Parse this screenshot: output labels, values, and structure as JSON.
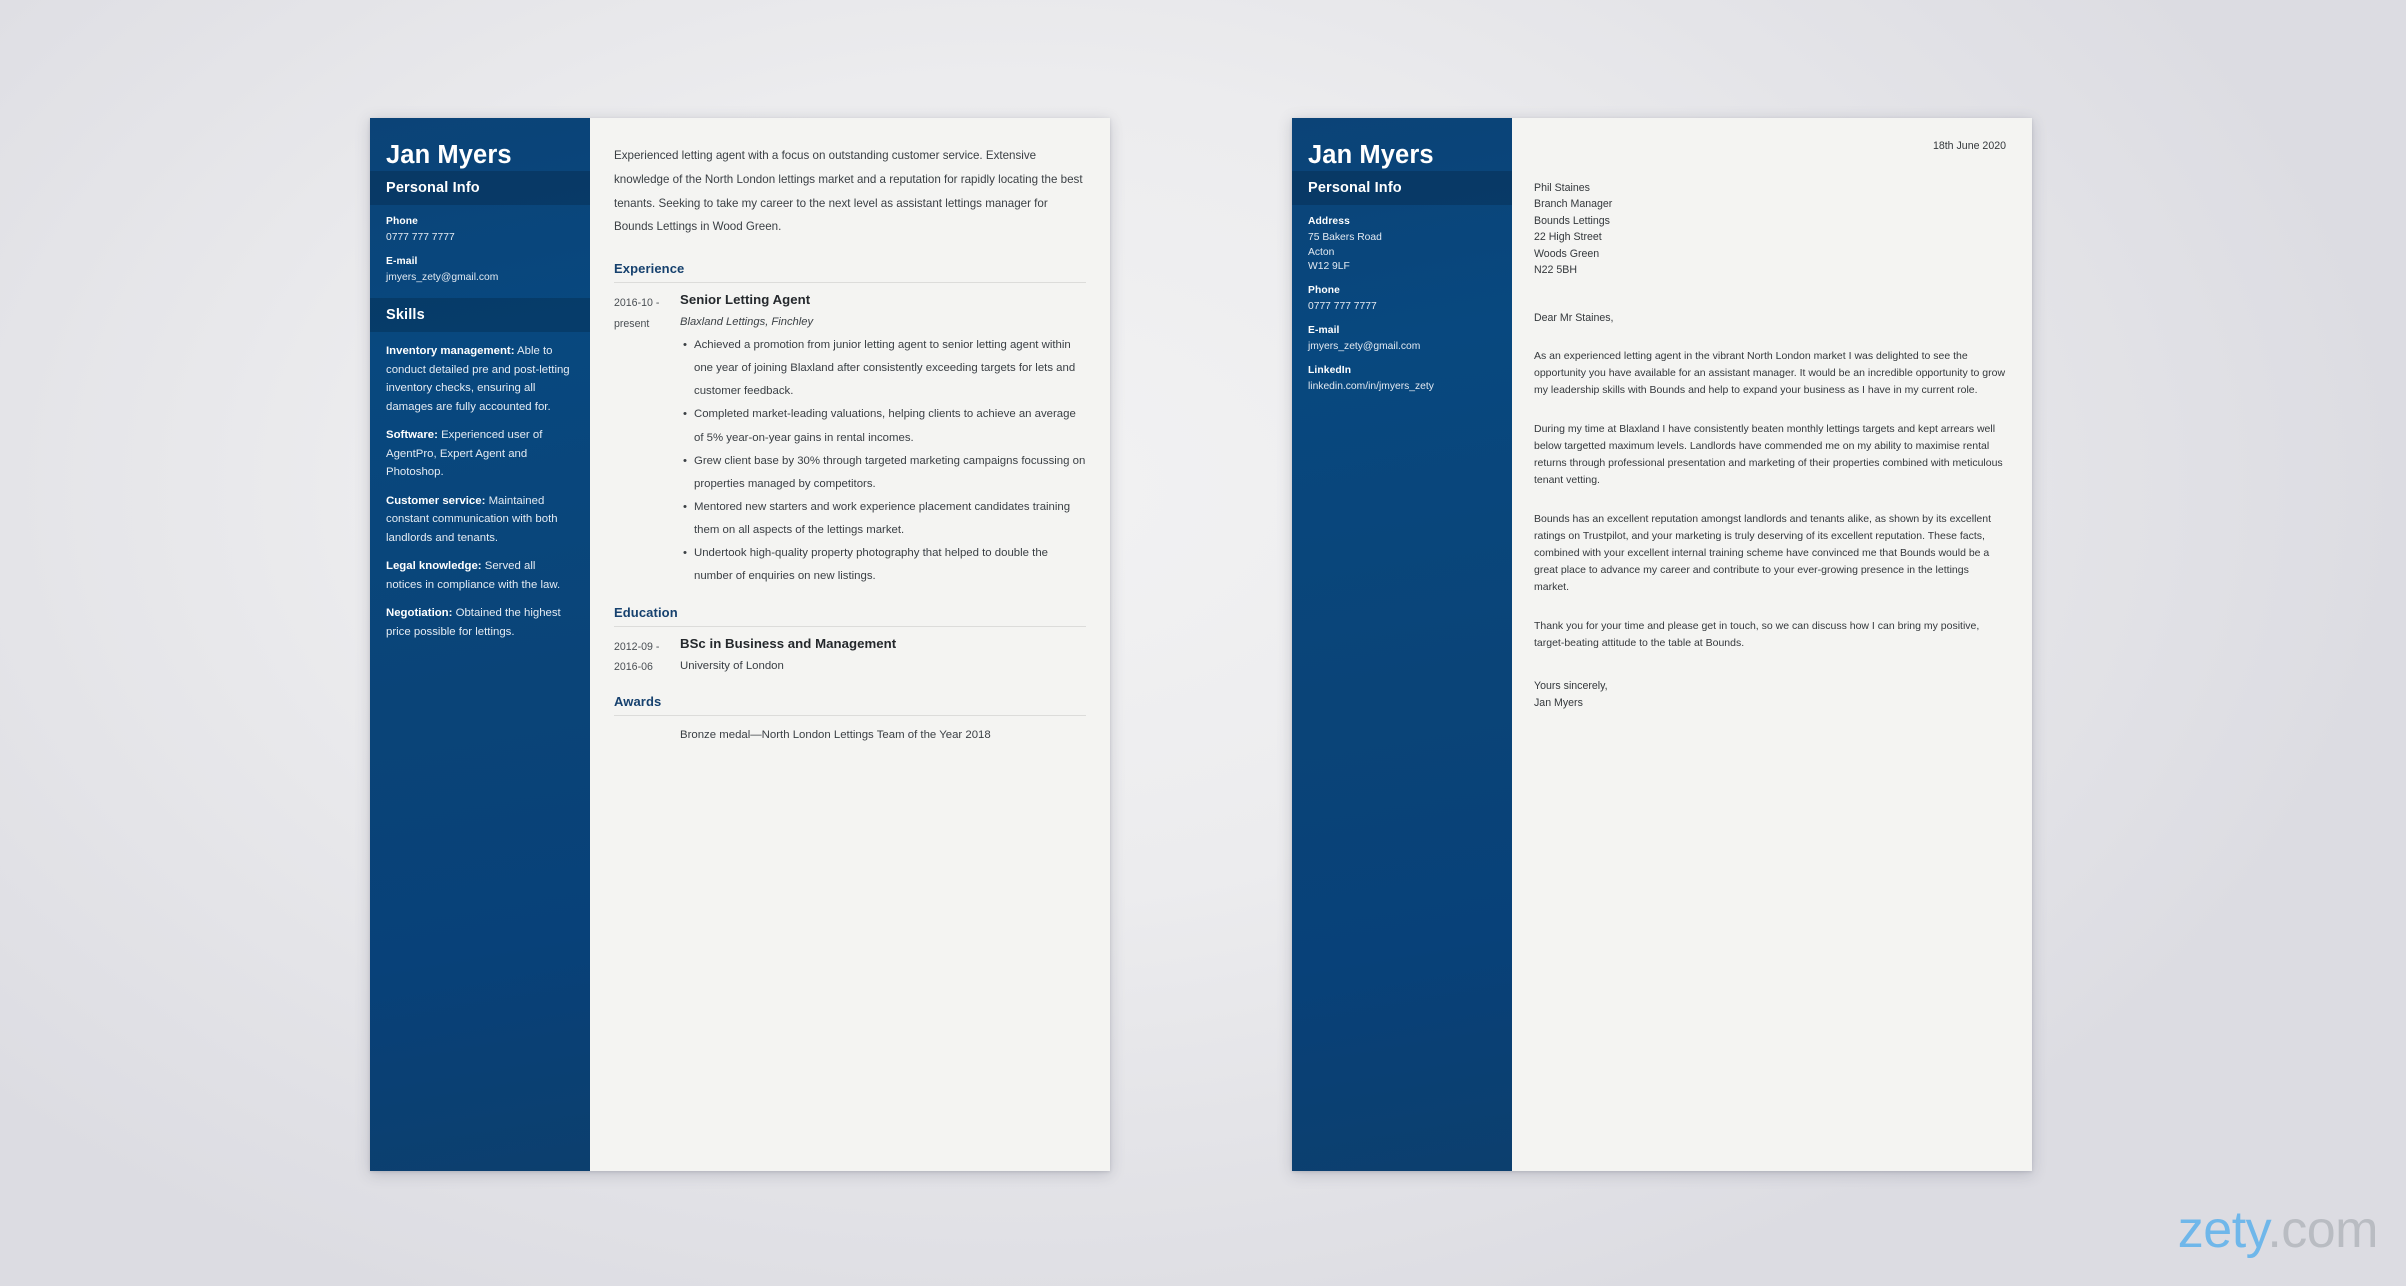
{
  "watermark": {
    "brand": "zety",
    "tld": ".com"
  },
  "resume": {
    "sidebar": {
      "name": "Jan Myers",
      "personal_info_heading": "Personal Info",
      "fields": [
        {
          "label": "Phone",
          "value": "0777 777 7777"
        },
        {
          "label": "E-mail",
          "value": "jmyers_zety@gmail.com"
        }
      ],
      "skills_heading": "Skills",
      "skills": [
        {
          "title": "Inventory management:",
          "text": " Able to conduct detailed pre and post-letting inventory checks, ensuring all damages are fully accounted for."
        },
        {
          "title": "Software:",
          "text": " Experienced user of AgentPro, Expert Agent and Photoshop."
        },
        {
          "title": "Customer service:",
          "text": " Maintained constant communication with both landlords and tenants."
        },
        {
          "title": "Legal knowledge:",
          "text": " Served all notices in compliance with the law."
        },
        {
          "title": "Negotiation:",
          "text": " Obtained the highest price possible for lettings."
        }
      ]
    },
    "summary": "Experienced letting agent with a focus on outstanding customer service. Extensive knowledge of the North London lettings market and a reputation for rapidly locating the best tenants. Seeking to take my career to the next level as assistant lettings manager for Bounds Lettings in Wood Green.",
    "experience": {
      "heading": "Experience",
      "date_from": "2016-10 -",
      "date_to": "present",
      "title": "Senior Letting Agent",
      "company": "Blaxland Lettings, Finchley",
      "bullets": [
        "Achieved a promotion from junior letting agent to senior letting agent within one year of joining Blaxland after consistently exceeding targets for lets and customer feedback.",
        "Completed market-leading valuations, helping clients to achieve an average of 5% year-on-year gains in rental incomes.",
        "Grew client base by 30% through targeted marketing campaigns focussing on properties managed by competitors.",
        "Mentored new starters and work experience placement candidates training them on all aspects of the lettings market.",
        "Undertook high-quality property photography that helped to double the number of enquiries on new listings."
      ]
    },
    "education": {
      "heading": "Education",
      "date_from": "2012-09 -",
      "date_to": "2016-06",
      "degree": "BSc in Business and Management",
      "institution": "University of London"
    },
    "awards": {
      "heading": "Awards",
      "item": "Bronze medal—North London Lettings Team of the Year 2018"
    }
  },
  "cover_letter": {
    "sidebar": {
      "name": "Jan Myers",
      "personal_info_heading": "Personal Info",
      "address_label": "Address",
      "address_lines": [
        "75 Bakers Road",
        "Acton",
        "W12 9LF"
      ],
      "fields": [
        {
          "label": "Phone",
          "value": "0777 777 7777"
        },
        {
          "label": "E-mail",
          "value": "jmyers_zety@gmail.com"
        },
        {
          "label": "LinkedIn",
          "value": "linkedin.com/in/jmyers_zety"
        }
      ]
    },
    "date": "18th June 2020",
    "recipient": [
      "Phil Staines",
      "Branch Manager",
      "Bounds Lettings",
      "22 High Street",
      "Woods Green",
      "N22 5BH"
    ],
    "salutation": "Dear Mr Staines,",
    "paragraphs": [
      "As an experienced letting agent in the vibrant North London market I was delighted to see the opportunity you have available for an assistant manager. It would be an incredible opportunity to grow my leadership skills with Bounds and help to expand your business as I have in my current role.",
      "During my time at Blaxland I have consistently beaten monthly lettings targets and kept arrears well below targetted maximum levels. Landlords have commended me on my ability to maximise rental returns through professional presentation and marketing of their properties combined with meticulous tenant vetting.",
      "Bounds has an excellent reputation amongst landlords and tenants alike, as shown by its excellent ratings on Trustpilot, and your marketing is truly deserving of its excellent reputation. These facts, combined with your excellent internal training scheme have convinced me that Bounds would be a great place to advance my career and contribute to your ever-growing presence in the lettings market.",
      "Thank you for your time and please get in touch, so we can discuss how I can bring my positive, target-beating attitude to the table at Bounds."
    ],
    "closing": "Yours sincerely,",
    "signature": "Jan Myers"
  },
  "colors": {
    "sidebar_blue": "#0a4478",
    "heading_blue": "#16416e",
    "page_bg": "#f4f4f2"
  }
}
